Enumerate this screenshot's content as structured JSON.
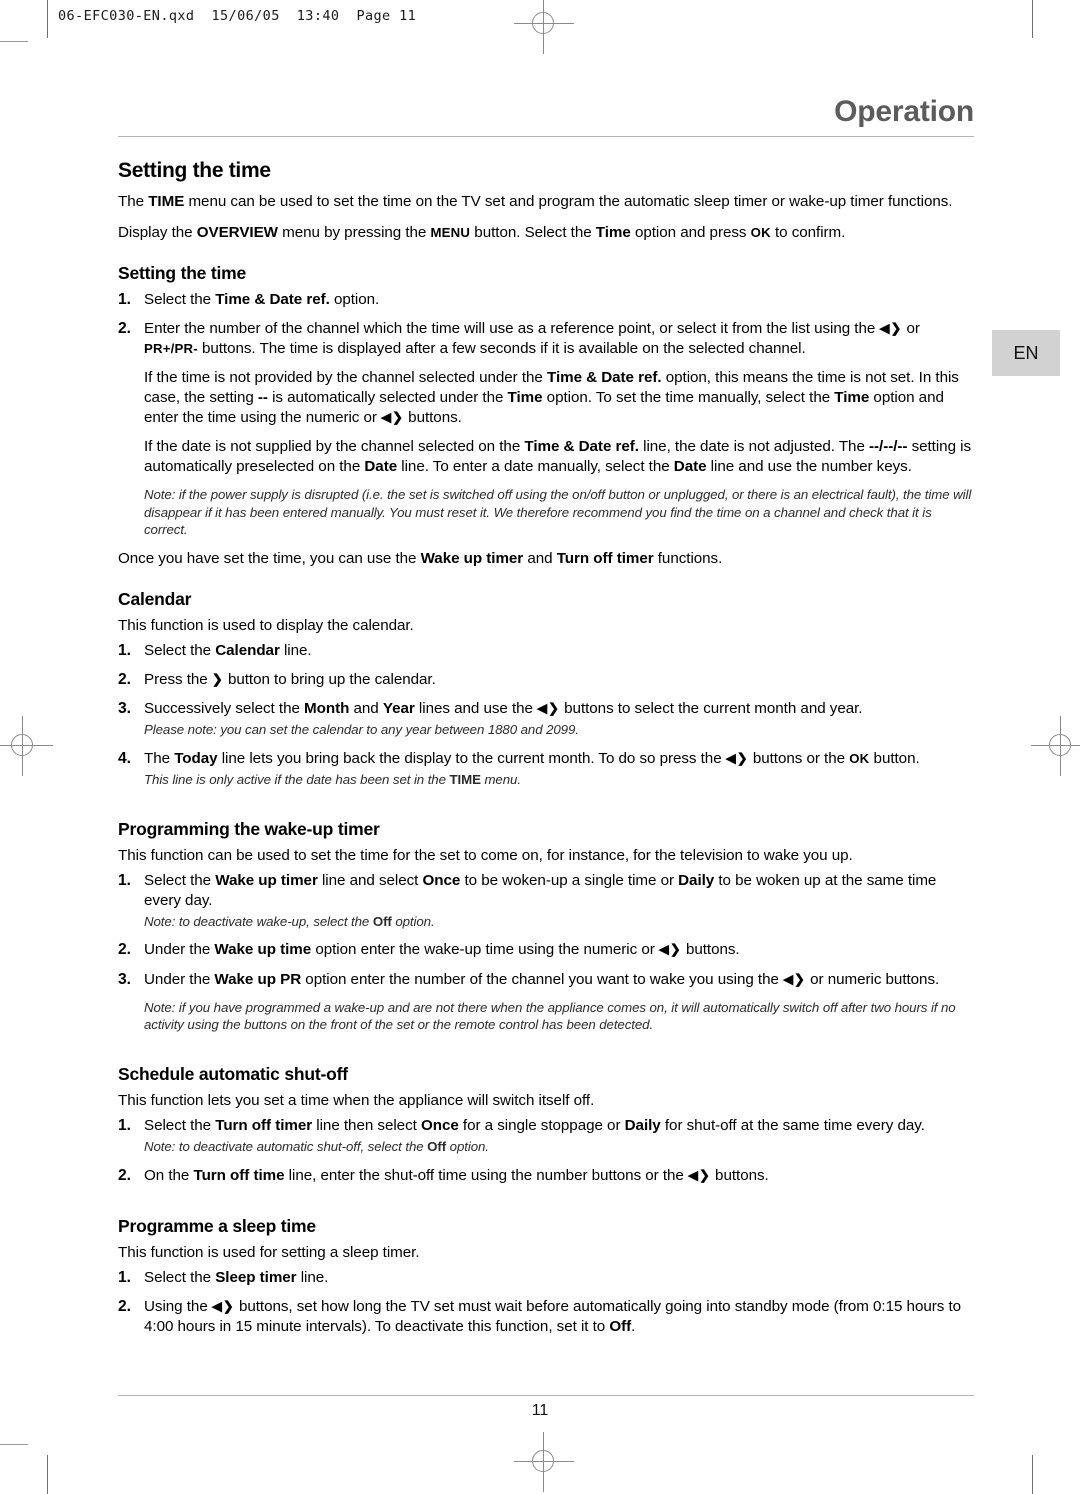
{
  "file_header": "06-EFC030-EN.qxd  15/06/05  13:40  Page 11",
  "chapter_title": "Operation",
  "language_tab": "EN",
  "page_number": "11",
  "icons": {
    "left_right_arrows": "◀❯",
    "right_arrow": "❯",
    "registration_mark": "registration-mark"
  },
  "sections": {
    "setting_the_time": {
      "heading": "Setting the time",
      "intro_1_pre": "The ",
      "intro_1_bold": "TIME",
      "intro_1_post": " menu can be used to set the time on the TV set and program the automatic sleep timer or wake-up timer functions.",
      "intro_2_a": "Display the ",
      "intro_2_b": "OVERVIEW",
      "intro_2_c": " menu by pressing the ",
      "intro_2_d": "MENU",
      "intro_2_e": " button. Select the ",
      "intro_2_f": "Time",
      "intro_2_g": " option and press ",
      "intro_2_h": "OK",
      "intro_2_i": " to confirm.",
      "subheading": "Setting the time",
      "step1_a": "Select the ",
      "step1_b": "Time & Date ref.",
      "step1_c": " option.",
      "step2_a": "Enter the number of the channel which the time will use as a reference point, or select it from the list using the ",
      "step2_b": " or ",
      "step2_c": "PR+/PR-",
      "step2_d": " buttons. The time is displayed after a few seconds if it is available on the selected channel.",
      "para_a1": "If the time is not provided by the channel selected under the ",
      "para_a2": "Time & Date ref.",
      "para_a3": " option, this means the time is not set. In this case, the setting ",
      "para_a4": "--",
      "para_a5": " is automatically selected under the ",
      "para_a6": "Time",
      "para_a7": " option. To set the time manually, select the ",
      "para_a8": "Time",
      "para_a9": " option and enter the time using the numeric or ",
      "para_a10": " buttons.",
      "para_b1": "If the date is not supplied by the channel selected on the ",
      "para_b2": "Time & Date ref.",
      "para_b3": " line, the date is not adjusted. The ",
      "para_b4": "--/--/--",
      "para_b5": " setting is automatically preselected on the ",
      "para_b6": "Date",
      "para_b7": " line. To enter a date manually, select the ",
      "para_b8": "Date",
      "para_b9": " line and use the number keys.",
      "note": "Note: if the power supply is disrupted (i.e. the set is switched off using the on/off button or unplugged, or there is an electrical fault), the time will disappear if it has been entered manually. You must reset it. We therefore recommend you find the time on a channel and check that it is correct.",
      "closing_a": "Once you have set the time, you can use the ",
      "closing_b": "Wake up timer",
      "closing_c": " and ",
      "closing_d": "Turn off timer",
      "closing_e": " functions."
    },
    "calendar": {
      "heading": "Calendar",
      "intro": "This function is used to display the calendar.",
      "step1_a": "Select the ",
      "step1_b": "Calendar",
      "step1_c": " line.",
      "step2_a": "Press the ",
      "step2_b": " button to bring up the calendar.",
      "step3_a": "Successively select the ",
      "step3_b": "Month",
      "step3_c": " and ",
      "step3_d": "Year",
      "step3_e": " lines and use the ",
      "step3_f": " buttons to select the current month and year.",
      "note3": "Please note: you can set the calendar to any year between 1880 and 2099.",
      "step4_a": "The ",
      "step4_b": "Today",
      "step4_c": " line lets you bring back the display to the current month. To do so press the ",
      "step4_d": " buttons or the ",
      "step4_e": "OK",
      "step4_f": " button.",
      "note4_a": "This line is only active if the date has been set in the ",
      "note4_b": "TIME",
      "note4_c": " menu."
    },
    "wake_up_timer": {
      "heading": "Programming the wake-up timer",
      "intro": "This function can be used to set the time for the set to come on, for instance, for the television to wake you up.",
      "step1_a": "Select the ",
      "step1_b": "Wake up timer",
      "step1_c": " line and select ",
      "step1_d": "Once",
      "step1_e": " to be woken-up a single time or ",
      "step1_f": "Daily",
      "step1_g": " to be woken up at the same time every day.",
      "note1_a": "Note: to deactivate wake-up, select the ",
      "note1_b": "Off",
      "note1_c": " option.",
      "step2_a": "Under the ",
      "step2_b": "Wake up time",
      "step2_c": " option enter the wake-up time using the numeric or ",
      "step2_d": " buttons.",
      "step3_a": "Under the ",
      "step3_b": "Wake up PR",
      "step3_c": " option enter the number of the channel you want to wake you using the ",
      "step3_d": " or numeric buttons.",
      "note_end": "Note: if you have programmed a wake-up and are not there when the appliance comes on, it will automatically switch off after two hours if no activity using the buttons on the front of the set or the remote control has been detected."
    },
    "shut_off": {
      "heading": "Schedule automatic shut-off",
      "intro": "This function lets you set a time when the appliance will switch itself off.",
      "step1_a": "Select the ",
      "step1_b": "Turn off timer",
      "step1_c": " line then select ",
      "step1_d": "Once",
      "step1_e": " for a single stoppage or ",
      "step1_f": "Daily",
      "step1_g": " for shut-off at the same time every day.",
      "note1_a": "Note: to deactivate automatic shut-off, select the ",
      "note1_b": "Off",
      "note1_c": " option.",
      "step2_a": "On the ",
      "step2_b": "Turn off time",
      "step2_c": " line, enter the shut-off time using the number buttons or the ",
      "step2_d": " buttons."
    },
    "sleep_time": {
      "heading": "Programme a sleep time",
      "intro": "This function is used for setting a sleep timer.",
      "step1_a": "Select the ",
      "step1_b": "Sleep timer",
      "step1_c": " line.",
      "step2_a": "Using the ",
      "step2_b": " buttons, set how long the TV set must wait before automatically going into standby mode (from 0:15 hours to 4:00 hours in 15 minute intervals). To deactivate this function, set it to ",
      "step2_c": "Off",
      "step2_d": "."
    }
  },
  "step_numbers": {
    "one": "1.",
    "two": "2.",
    "three": "3.",
    "four": "4."
  },
  "colors": {
    "chapter_title": "#5c5c5c",
    "rule": "#b3b3b3",
    "lang_tab_bg": "#d2d2d2",
    "text": "#000000"
  }
}
